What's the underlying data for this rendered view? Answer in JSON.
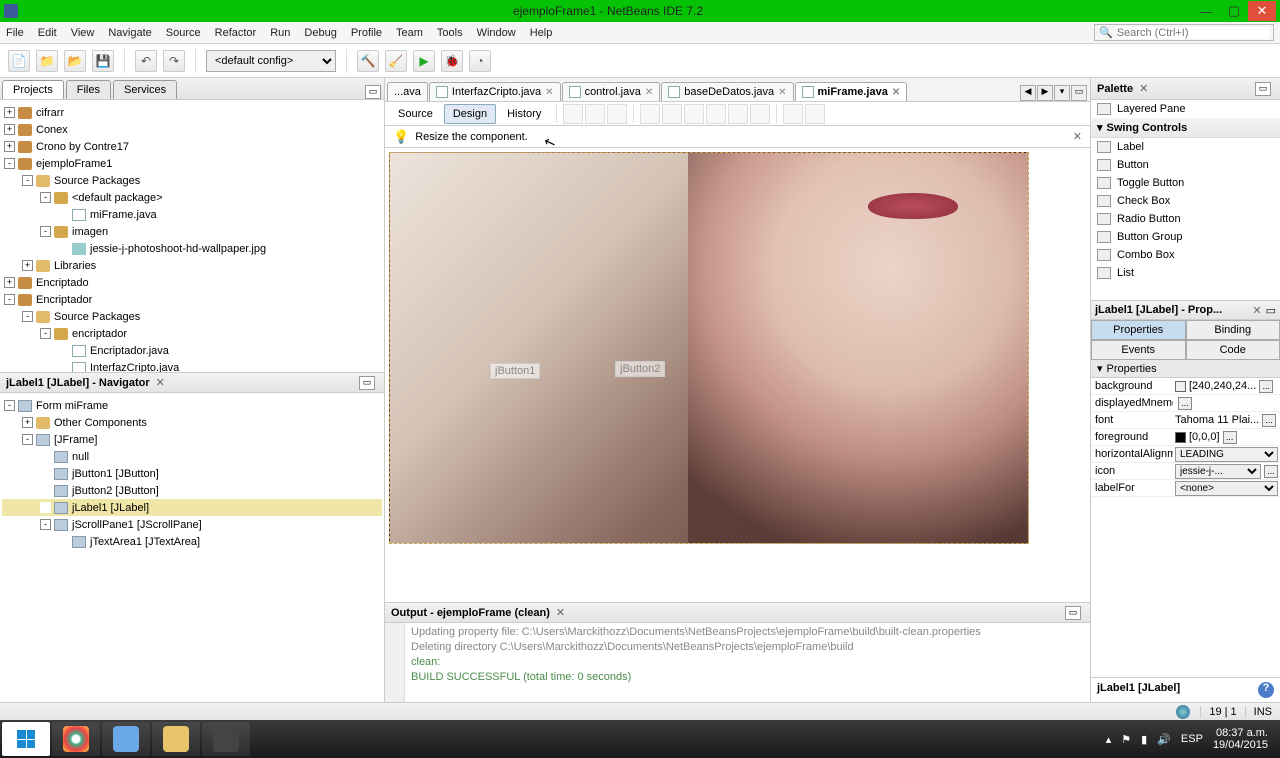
{
  "window": {
    "title": "ejemploFrame1 - NetBeans IDE 7.2"
  },
  "menu": {
    "file": "File",
    "edit": "Edit",
    "view": "View",
    "navigate": "Navigate",
    "source": "Source",
    "refactor": "Refactor",
    "run": "Run",
    "debug": "Debug",
    "profile": "Profile",
    "team": "Team",
    "tools": "Tools",
    "window": "Window",
    "help": "Help",
    "search_ph": "Search (Ctrl+I)"
  },
  "toolbar": {
    "config": "<default config>"
  },
  "projects": {
    "tab_projects": "Projects",
    "tab_files": "Files",
    "tab_services": "Services",
    "items": [
      "cifrarr",
      "Conex",
      "Crono by Contre17",
      "ejemploFrame1",
      "Source Packages",
      "<default package>",
      "miFrame.java",
      "imagen",
      "jessie-j-photoshoot-hd-wallpaper.jpg",
      "Libraries",
      "Encriptado",
      "Encriptador",
      "Source Packages",
      "encriptador",
      "Encriptador.java",
      "InterfazCripto.java"
    ]
  },
  "navigator": {
    "title": "jLabel1 [JLabel] - Navigator",
    "items": [
      "Form miFrame",
      "Other Components",
      "[JFrame]",
      "null",
      "jButton1 [JButton]",
      "jButton2 [JButton]",
      "jLabel1 [JLabel]",
      "jScrollPane1 [JScrollPane]",
      "jTextArea1 [JTextArea]"
    ]
  },
  "editor": {
    "tabs": [
      "...ava",
      "InterfazCripto.java",
      "control.java",
      "baseDeDatos.java",
      "miFrame.java"
    ],
    "sub": {
      "source": "Source",
      "design": "Design",
      "history": "History"
    },
    "hint": "Resize the component.",
    "btn1": "jButton1",
    "btn2": "jButton2"
  },
  "output": {
    "title": "Output - ejemploFrame (clean)",
    "l1": "Updating property file: C:\\Users\\Marckithozz\\Documents\\NetBeansProjects\\ejemploFrame\\build\\built-clean.properties",
    "l2": "Deleting directory C:\\Users\\Marckithozz\\Documents\\NetBeansProjects\\ejemploFrame\\build",
    "l3": "clean:",
    "l4": "BUILD SUCCESSFUL (total time: 0 seconds)"
  },
  "palette": {
    "title": "Palette",
    "item_layered": "Layered Pane",
    "cat_swing": "Swing Controls",
    "items": [
      "Label",
      "Button",
      "Toggle Button",
      "Check Box",
      "Radio Button",
      "Button Group",
      "Combo Box",
      "List"
    ]
  },
  "props": {
    "header": "jLabel1 [JLabel] - Prop...",
    "tab_p": "Properties",
    "tab_b": "Binding",
    "tab_e": "Events",
    "tab_c": "Code",
    "section": "Properties",
    "rows": {
      "background": {
        "n": "background",
        "v": "[240,240,24...",
        "c": "#f0f0f0"
      },
      "displayedMnemon": {
        "n": "displayedMnemon",
        "v": ""
      },
      "font": {
        "n": "font",
        "v": "Tahoma 11 Plai..."
      },
      "foreground": {
        "n": "foreground",
        "v": "[0,0,0]",
        "c": "#000"
      },
      "horizontalAlign": {
        "n": "horizontalAlignme",
        "v": "LEADING"
      },
      "icon": {
        "n": "icon",
        "v": "jessie-j-..."
      },
      "labelFor": {
        "n": "labelFor",
        "v": "<none>"
      }
    },
    "help": "jLabel1 [JLabel]"
  },
  "status": {
    "pos": "19 | 1",
    "ins": "INS"
  },
  "taskbar": {
    "lang": "ESP",
    "time": "08:37 a.m.",
    "date": "19/04/2015"
  }
}
